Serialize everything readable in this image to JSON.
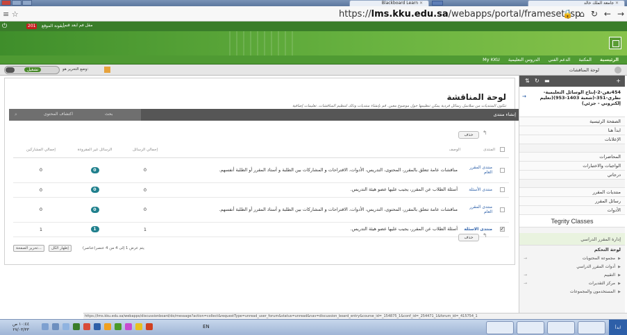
{
  "browser": {
    "tab_active": "Blackboard Learn",
    "tab_other": "جامعة الملك خالد",
    "url_prefix": "https://",
    "url_host": "lms.kku.edu.sa",
    "url_path": "/webapps/portal/frameset.jsp"
  },
  "bookmarks": {
    "badge": "201",
    "badge_text": "أيقونة الموقع",
    "item": "مقل فم ابعد قنم"
  },
  "nav": {
    "items": [
      "الرئيسية",
      "المكتبة",
      "الدعم الفني",
      "الدروس التعليمية",
      "My KKU"
    ],
    "active_index": 0
  },
  "breadcrumb": {
    "title": "لوحة المناقشات",
    "edit_mode": "تشغيل",
    "edit_label": "وضع التحرير هو:"
  },
  "page": {
    "title": "لوحة المناقشة",
    "description": "تتكون المنتديات من سلاسل رسائل فردية يمكن تنظيمها حول موضوع معين. قم بإنشاء منتديات وذلك لتنظيم المناقشات. تعليمات إضافية"
  },
  "actions": {
    "create": "إنشاء منتدى",
    "search": "بحث",
    "discover": "اكتشاف المحتوى",
    "delete": "حذف"
  },
  "table": {
    "headers": {
      "forum": "المنتدى",
      "description": "الوصف",
      "total_posts": "إجمالي الرسائل",
      "unread": "الرسائل غير المقروءة",
      "participants": "إجمالي المشاركين"
    },
    "rows": [
      {
        "forum": "منتدى المقرر العام",
        "description": "مناقشات عامة تتعلق بالمقرر، المحتوى، التدريس، الأدوات، الاقتراحات و المشاركات بين الطلبة و أستاذ المقرر أو الطلبة أنفسهم.",
        "total_posts": "0",
        "unread": "0",
        "participants": "0",
        "checked": false,
        "bold": false
      },
      {
        "forum": "منتدى الأسئلة",
        "description": "أسئلة الطلاب عن المقرر، يجيب عليها عضو هيئة التدريس.",
        "total_posts": "0",
        "unread": "0",
        "participants": "0",
        "checked": false,
        "bold": false
      },
      {
        "forum": "منتدى المقرر العام",
        "description": "مناقشات عامة تتعلق بالمقرر، المحتوى، التدريس، الأدوات، الاقتراحات و المشاركات بين الطلبة و أستاذ المقرر أو الطلبة أنفسهم.",
        "total_posts": "0",
        "unread": "0",
        "participants": "0",
        "checked": false,
        "bold": false
      },
      {
        "forum": "منتدى الاسئلة",
        "description": "أسئلة الطلاب عن المقرر، يجيب عليها عضو هيئة التدريس.",
        "total_posts": "1",
        "unread": "1",
        "participants": "1",
        "checked": true,
        "bold": true
      }
    ]
  },
  "paging": {
    "info": "يتم عرض 1 إلى 4 من 4 عنصر(عناصر)",
    "show_all": "إظهار الكل",
    "edit_paging": "تحرير الصفحة..."
  },
  "sidebar": {
    "course": "454تقن-2-إنتاج الوسائل التعليمية-نظري-351-(شعبة 1403-953)(تعليم إلكتروني - جزئي)",
    "items": [
      "الصفحة الرئيسية",
      "ابدأ هنا",
      "الإعلانات"
    ],
    "items2": [
      "المحاضرات",
      "الواجبات والاختبارات",
      "درجاتي"
    ],
    "items3": [
      "منتديات المقرر",
      "رسائل المقرر",
      "الأدوات"
    ],
    "tegrity": "Tegrity Classes",
    "management": "إدارة المقرر الدراسي",
    "control_panel": "لوحة التحكم",
    "cp_items": [
      "مجموعة المحتويات",
      "أدوات المقرر الدراسي",
      "التقييم",
      "مركز التقديرات",
      "المستخدمون والمجموعات"
    ]
  },
  "statusbar": {
    "text": "https://lms.kku.edu.sa/webapps/discussionboard/do/message?action=collect&requestType=unread_user_forum&status=unread&nav=discussion_board_entry&course_id=_154875_1&conf_id=_254471_1&forum_id=_415754_1"
  },
  "taskbar": {
    "time": "١٠:٤٤ ص",
    "date": "٢٧/٠٣/٣٣",
    "lang": "EN",
    "start": "ابدأ"
  },
  "colors": {
    "header_green": "#4f9a33",
    "action_bar": "#565656",
    "unread_badge": "#20808d",
    "link_blue": "#2a5ea8"
  }
}
